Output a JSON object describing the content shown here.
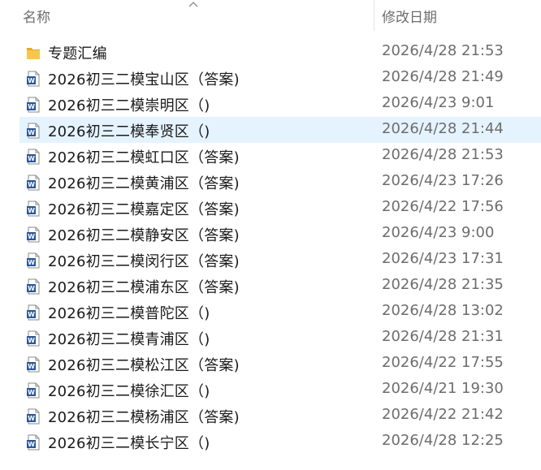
{
  "header": {
    "name_label": "名称",
    "date_label": "修改日期"
  },
  "items": [
    {
      "type": "folder",
      "name": "专题汇编",
      "date": "2026/4/28 21:53",
      "selected": false
    },
    {
      "type": "word",
      "name": "2026初三二模宝山区（答案)",
      "date": "2026/4/28 21:49",
      "selected": false
    },
    {
      "type": "word",
      "name": "2026初三二模崇明区（)",
      "date": "2026/4/23 9:01",
      "selected": false
    },
    {
      "type": "word",
      "name": "2026初三二模奉贤区（)",
      "date": "2026/4/28 21:44",
      "selected": true
    },
    {
      "type": "word",
      "name": "2026初三二模虹口区（答案)",
      "date": "2026/4/28 21:53",
      "selected": false
    },
    {
      "type": "word",
      "name": "2026初三二模黄浦区（答案)",
      "date": "2026/4/23 17:26",
      "selected": false
    },
    {
      "type": "word",
      "name": "2026初三二模嘉定区（答案)",
      "date": "2026/4/22 17:56",
      "selected": false
    },
    {
      "type": "word",
      "name": "2026初三二模静安区（答案)",
      "date": "2026/4/23 9:00",
      "selected": false
    },
    {
      "type": "word",
      "name": "2026初三二模闵行区（答案)",
      "date": "2026/4/23 17:31",
      "selected": false
    },
    {
      "type": "word",
      "name": "2026初三二模浦东区（答案)",
      "date": "2026/4/28 21:35",
      "selected": false
    },
    {
      "type": "word",
      "name": "2026初三二模普陀区（)",
      "date": "2026/4/28 13:02",
      "selected": false
    },
    {
      "type": "word",
      "name": "2026初三二模青浦区（)",
      "date": "2026/4/28 21:31",
      "selected": false
    },
    {
      "type": "word",
      "name": "2026初三二模松江区（答案)",
      "date": "2026/4/22 17:55",
      "selected": false
    },
    {
      "type": "word",
      "name": "2026初三二模徐汇区（)",
      "date": "2026/4/21 19:30",
      "selected": false
    },
    {
      "type": "word",
      "name": "2026初三二模杨浦区（答案)",
      "date": "2026/4/22 21:42",
      "selected": false
    },
    {
      "type": "word",
      "name": "2026初三二模长宁区（)",
      "date": "2026/4/28 12:25",
      "selected": false
    }
  ],
  "icons": {
    "folder": "folder-icon",
    "word": "word-document-icon",
    "sort": "sort-ascending-icon"
  },
  "colors": {
    "selection": "#e5f3ff",
    "word_blue": "#2b5797",
    "folder_yellow": "#f8c74a"
  }
}
